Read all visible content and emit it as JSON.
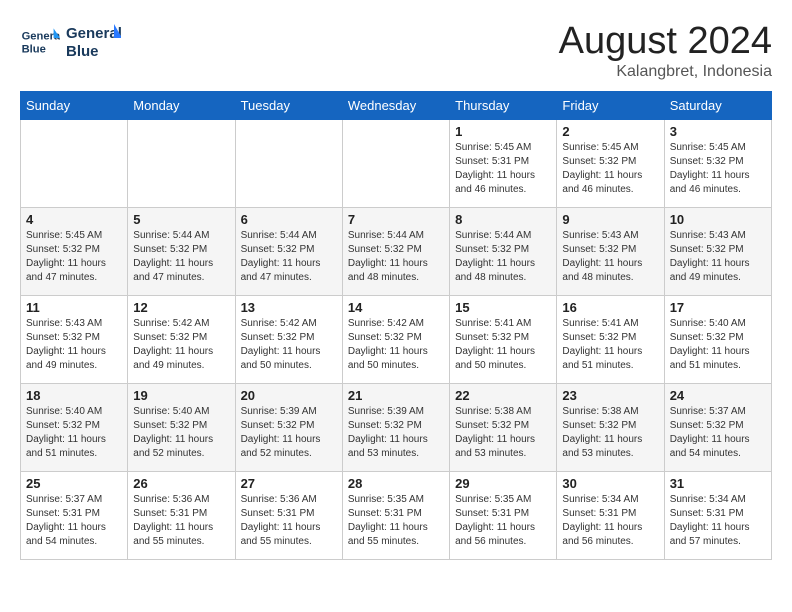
{
  "logo": {
    "line1": "General",
    "line2": "Blue"
  },
  "title": "August 2024",
  "location": "Kalangbret, Indonesia",
  "days_of_week": [
    "Sunday",
    "Monday",
    "Tuesday",
    "Wednesday",
    "Thursday",
    "Friday",
    "Saturday"
  ],
  "weeks": [
    [
      {
        "day": "",
        "info": ""
      },
      {
        "day": "",
        "info": ""
      },
      {
        "day": "",
        "info": ""
      },
      {
        "day": "",
        "info": ""
      },
      {
        "day": "1",
        "info": "Sunrise: 5:45 AM\nSunset: 5:31 PM\nDaylight: 11 hours\nand 46 minutes."
      },
      {
        "day": "2",
        "info": "Sunrise: 5:45 AM\nSunset: 5:32 PM\nDaylight: 11 hours\nand 46 minutes."
      },
      {
        "day": "3",
        "info": "Sunrise: 5:45 AM\nSunset: 5:32 PM\nDaylight: 11 hours\nand 46 minutes."
      }
    ],
    [
      {
        "day": "4",
        "info": "Sunrise: 5:45 AM\nSunset: 5:32 PM\nDaylight: 11 hours\nand 47 minutes."
      },
      {
        "day": "5",
        "info": "Sunrise: 5:44 AM\nSunset: 5:32 PM\nDaylight: 11 hours\nand 47 minutes."
      },
      {
        "day": "6",
        "info": "Sunrise: 5:44 AM\nSunset: 5:32 PM\nDaylight: 11 hours\nand 47 minutes."
      },
      {
        "day": "7",
        "info": "Sunrise: 5:44 AM\nSunset: 5:32 PM\nDaylight: 11 hours\nand 48 minutes."
      },
      {
        "day": "8",
        "info": "Sunrise: 5:44 AM\nSunset: 5:32 PM\nDaylight: 11 hours\nand 48 minutes."
      },
      {
        "day": "9",
        "info": "Sunrise: 5:43 AM\nSunset: 5:32 PM\nDaylight: 11 hours\nand 48 minutes."
      },
      {
        "day": "10",
        "info": "Sunrise: 5:43 AM\nSunset: 5:32 PM\nDaylight: 11 hours\nand 49 minutes."
      }
    ],
    [
      {
        "day": "11",
        "info": "Sunrise: 5:43 AM\nSunset: 5:32 PM\nDaylight: 11 hours\nand 49 minutes."
      },
      {
        "day": "12",
        "info": "Sunrise: 5:42 AM\nSunset: 5:32 PM\nDaylight: 11 hours\nand 49 minutes."
      },
      {
        "day": "13",
        "info": "Sunrise: 5:42 AM\nSunset: 5:32 PM\nDaylight: 11 hours\nand 50 minutes."
      },
      {
        "day": "14",
        "info": "Sunrise: 5:42 AM\nSunset: 5:32 PM\nDaylight: 11 hours\nand 50 minutes."
      },
      {
        "day": "15",
        "info": "Sunrise: 5:41 AM\nSunset: 5:32 PM\nDaylight: 11 hours\nand 50 minutes."
      },
      {
        "day": "16",
        "info": "Sunrise: 5:41 AM\nSunset: 5:32 PM\nDaylight: 11 hours\nand 51 minutes."
      },
      {
        "day": "17",
        "info": "Sunrise: 5:40 AM\nSunset: 5:32 PM\nDaylight: 11 hours\nand 51 minutes."
      }
    ],
    [
      {
        "day": "18",
        "info": "Sunrise: 5:40 AM\nSunset: 5:32 PM\nDaylight: 11 hours\nand 51 minutes."
      },
      {
        "day": "19",
        "info": "Sunrise: 5:40 AM\nSunset: 5:32 PM\nDaylight: 11 hours\nand 52 minutes."
      },
      {
        "day": "20",
        "info": "Sunrise: 5:39 AM\nSunset: 5:32 PM\nDaylight: 11 hours\nand 52 minutes."
      },
      {
        "day": "21",
        "info": "Sunrise: 5:39 AM\nSunset: 5:32 PM\nDaylight: 11 hours\nand 53 minutes."
      },
      {
        "day": "22",
        "info": "Sunrise: 5:38 AM\nSunset: 5:32 PM\nDaylight: 11 hours\nand 53 minutes."
      },
      {
        "day": "23",
        "info": "Sunrise: 5:38 AM\nSunset: 5:32 PM\nDaylight: 11 hours\nand 53 minutes."
      },
      {
        "day": "24",
        "info": "Sunrise: 5:37 AM\nSunset: 5:32 PM\nDaylight: 11 hours\nand 54 minutes."
      }
    ],
    [
      {
        "day": "25",
        "info": "Sunrise: 5:37 AM\nSunset: 5:31 PM\nDaylight: 11 hours\nand 54 minutes."
      },
      {
        "day": "26",
        "info": "Sunrise: 5:36 AM\nSunset: 5:31 PM\nDaylight: 11 hours\nand 55 minutes."
      },
      {
        "day": "27",
        "info": "Sunrise: 5:36 AM\nSunset: 5:31 PM\nDaylight: 11 hours\nand 55 minutes."
      },
      {
        "day": "28",
        "info": "Sunrise: 5:35 AM\nSunset: 5:31 PM\nDaylight: 11 hours\nand 55 minutes."
      },
      {
        "day": "29",
        "info": "Sunrise: 5:35 AM\nSunset: 5:31 PM\nDaylight: 11 hours\nand 56 minutes."
      },
      {
        "day": "30",
        "info": "Sunrise: 5:34 AM\nSunset: 5:31 PM\nDaylight: 11 hours\nand 56 minutes."
      },
      {
        "day": "31",
        "info": "Sunrise: 5:34 AM\nSunset: 5:31 PM\nDaylight: 11 hours\nand 57 minutes."
      }
    ]
  ]
}
